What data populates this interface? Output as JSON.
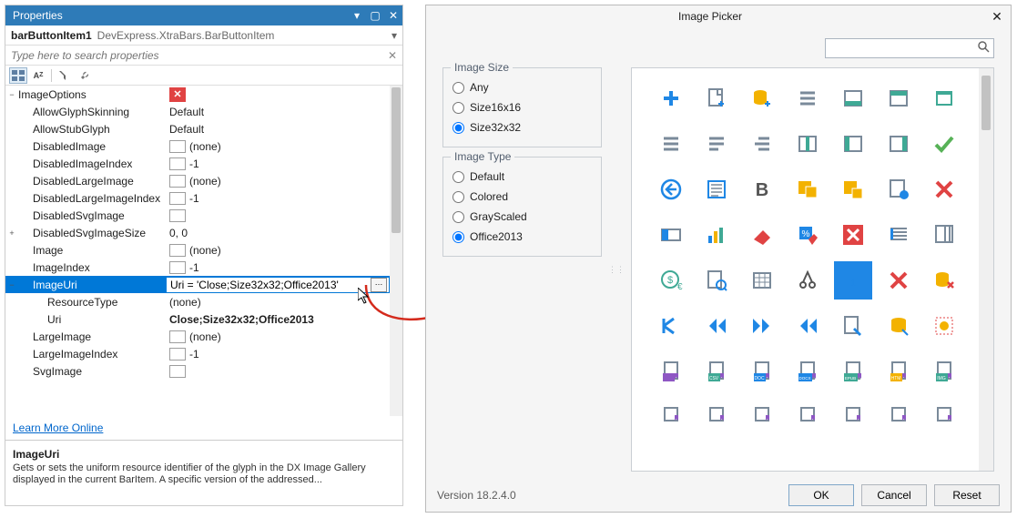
{
  "properties": {
    "title": "Properties",
    "selector": {
      "name": "barButtonItem1",
      "type": "DevExpress.XtraBars.BarButtonItem"
    },
    "search_placeholder": "Type here to search properties",
    "link": "Learn More Online",
    "description": {
      "title": "ImageUri",
      "text": "Gets or sets the uniform resource identifier of the glyph in the DX Image Gallery displayed in the current BarItem. A specific version of the addressed..."
    },
    "rows": [
      {
        "label": "ImageOptions",
        "expander": "−",
        "indent": 0,
        "value_icon": "red-x"
      },
      {
        "label": "AllowGlyphSkinning",
        "indent": 1,
        "value": "Default"
      },
      {
        "label": "AllowStubGlyph",
        "indent": 1,
        "value": "Default"
      },
      {
        "label": "DisabledImage",
        "indent": 1,
        "checkbox": true,
        "value": "(none)"
      },
      {
        "label": "DisabledImageIndex",
        "indent": 1,
        "checkbox": true,
        "value": "-1"
      },
      {
        "label": "DisabledLargeImage",
        "indent": 1,
        "checkbox": true,
        "value": "(none)"
      },
      {
        "label": "DisabledLargeImageIndex",
        "indent": 1,
        "checkbox": true,
        "value": "-1"
      },
      {
        "label": "DisabledSvgImage",
        "indent": 1,
        "checkbox": true,
        "value": ""
      },
      {
        "label": "DisabledSvgImageSize",
        "expander": "+",
        "indent": 1,
        "value": "0, 0"
      },
      {
        "label": "Image",
        "indent": 1,
        "checkbox": true,
        "value": "(none)"
      },
      {
        "label": "ImageIndex",
        "indent": 1,
        "checkbox": true,
        "value": "-1"
      },
      {
        "label": "ImageUri",
        "expander": "−",
        "indent": 1,
        "value": "Uri = 'Close;Size32x32;Office2013'",
        "selected": true,
        "ellipsis": true
      },
      {
        "label": "ResourceType",
        "indent": 2,
        "value": "(none)"
      },
      {
        "label": "Uri",
        "indent": 2,
        "value": "Close;Size32x32;Office2013",
        "bold": true
      },
      {
        "label": "LargeImage",
        "indent": 1,
        "checkbox": true,
        "value": "(none)"
      },
      {
        "label": "LargeImageIndex",
        "indent": 1,
        "checkbox": true,
        "value": "-1"
      },
      {
        "label": "SvgImage",
        "indent": 1,
        "checkbox": true,
        "value": ""
      }
    ]
  },
  "picker": {
    "title": "Image Picker",
    "size_group": "Image Size",
    "type_group": "Image Type",
    "sizes": [
      {
        "label": "Any",
        "checked": false
      },
      {
        "label": "Size16x16",
        "checked": false
      },
      {
        "label": "Size32x32",
        "checked": true
      }
    ],
    "types": [
      {
        "label": "Default",
        "checked": false
      },
      {
        "label": "Colored",
        "checked": false
      },
      {
        "label": "GrayScaled",
        "checked": false
      },
      {
        "label": "Office2013",
        "checked": true
      }
    ],
    "version": "Version 18.2.4.0",
    "buttons": {
      "ok": "OK",
      "cancel": "Cancel",
      "reset": "Reset"
    },
    "selected_index": 32
  }
}
